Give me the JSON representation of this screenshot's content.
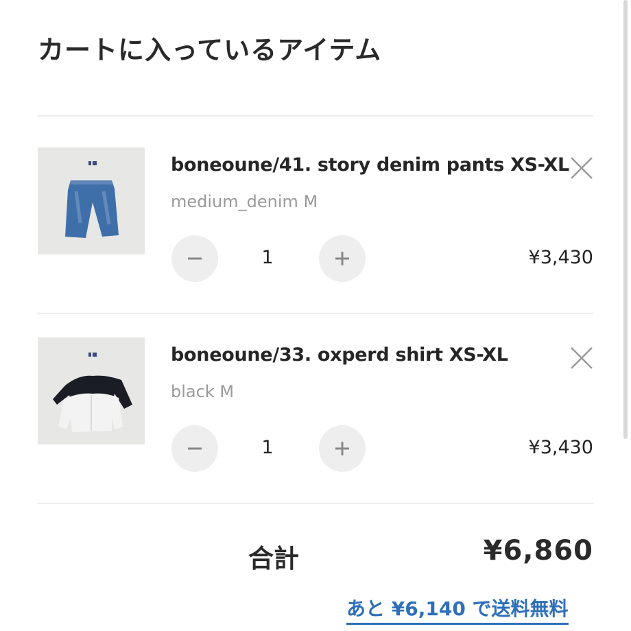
{
  "page": {
    "title": "カートに入っているアイテム"
  },
  "cart": {
    "items": [
      {
        "name": "boneoune/41. story denim pants XS-XL",
        "variant": "medium_denim M",
        "quantity": "1",
        "price": "¥3,430",
        "image": "denim-pants-photo"
      },
      {
        "name": "boneoune/33. oxperd shirt XS-XL",
        "variant": "black M",
        "quantity": "1",
        "price": "¥3,430",
        "image": "shirts-photo"
      }
    ],
    "total_label": "合計",
    "total_value": "¥6,860",
    "shipping_note": "あと ¥6,140 で送料無料"
  },
  "icons": {
    "remove": "close-icon",
    "decrease": "minus-icon",
    "increase": "plus-icon"
  },
  "colors": {
    "accent": "#2d6fb8",
    "divider": "#ececec",
    "button_bg": "#eeeeee",
    "muted_text": "#9a9a9a"
  }
}
